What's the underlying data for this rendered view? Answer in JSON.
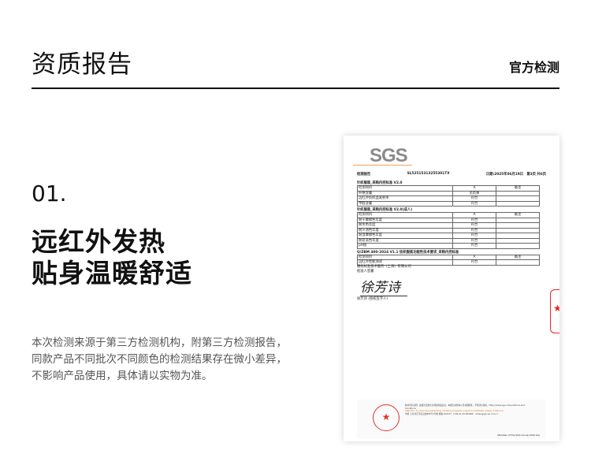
{
  "header": {
    "title": "资质报告",
    "tag": "官方检测"
  },
  "section": {
    "number": "01.",
    "headline1": "远红外发热",
    "headline2": "贴身温暖舒适",
    "para": [
      "本次检测来源于第三方检测机构，附第三方检测报告，",
      "同款产品不同批次不同颜色的检测结果存在微小差异，",
      "不影响产品使用，具体请以实物为准。"
    ]
  },
  "doc": {
    "logo": "SGS",
    "label": "检测报告",
    "report_no": "SL52515313255301TX",
    "date": "日期:2025年06月19日　第3页 共6页",
    "tables": [
      {
        "title": "针织服装_采购内控标准 V2.0",
        "rows": [
          [
            "检测项目",
            "A",
            "备注"
          ],
          [
            "纤维含量",
            "见结果",
            ""
          ],
          [
            "远红外纺织品发射率",
            "符合",
            ""
          ],
          [
            "甲醛含量",
            "符合",
            ""
          ]
        ]
      },
      {
        "title": "针织服装_采购内控标准 V2.0(成人)",
        "rows": [
          [
            "检测项目",
            "A",
            "备注"
          ],
          [
            "耐干摩擦色牢度",
            "符合",
            ""
          ],
          [
            "耐水色牢度",
            "符合",
            ""
          ],
          [
            "耐汗渍色牢度",
            "符合",
            ""
          ],
          [
            "耐湿摩擦色牢度",
            "符合",
            ""
          ],
          [
            "耐皂洗色牢度",
            "符合",
            ""
          ],
          [
            "pH值",
            "符合",
            ""
          ]
        ]
      },
      {
        "title": "Q/ZBM 400-2024 V1.1 纺织服装功能性技术要求_采购内控标准",
        "rows": [
          [
            "检测项目",
            "A",
            "备注"
          ],
          [
            "远红外性能测试",
            "符合",
            ""
          ]
        ]
      }
    ],
    "company": "通标标准技术服务（上海）有限公司",
    "approver_label": "批准人签署",
    "signature": "徐芳诗",
    "signer": "徐芳诗 (授权签字人)",
    "footer_text": "除非另有说明，此报告结果仅对测试样品负责。本报告未经本公司书面批准，不得部分复制。https://www.sgs.com/en/Terms-and-Conditions",
    "footer_attention": "Attention: To check the authenticity of testing /inspection report & certificate, please contact us.",
    "footer_address": "中国·上海·徐汇区宜山路889号3号楼 邮编 200233　t (86-21) 61402666　www.sgsgroup.com.cn",
    "member": "Member of the SGS Group (SGS SA)"
  }
}
